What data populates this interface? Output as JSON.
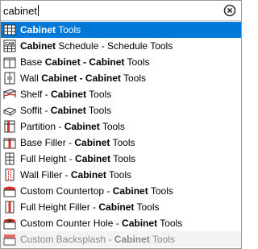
{
  "search": {
    "value": "cabinet",
    "placeholder": ""
  },
  "results": [
    {
      "icon": "cabinet-tools-icon",
      "match": "Cabinet",
      "rest": " Tools",
      "selected": true
    },
    {
      "icon": "cabinet-schedule-icon",
      "match": "Cabinet",
      "rest": " Schedule - Schedule Tools"
    },
    {
      "icon": "base-cabinet-icon",
      "prefix": "Base ",
      "match": "Cabinet - Cabinet",
      "rest": " Tools"
    },
    {
      "icon": "wall-cabinet-icon",
      "prefix": "Wall ",
      "match": "Cabinet - Cabinet",
      "rest": " Tools"
    },
    {
      "icon": "shelf-icon",
      "prefix": "Shelf - ",
      "match": "Cabinet",
      "rest": " Tools"
    },
    {
      "icon": "soffit-icon",
      "prefix": "Soffit - ",
      "match": "Cabinet",
      "rest": " Tools"
    },
    {
      "icon": "partition-icon",
      "prefix": "Partition - ",
      "match": "Cabinet",
      "rest": " Tools"
    },
    {
      "icon": "base-filler-icon",
      "prefix": "Base Filler - ",
      "match": "Cabinet",
      "rest": " Tools"
    },
    {
      "icon": "full-height-icon",
      "prefix": "Full Height - ",
      "match": "Cabinet",
      "rest": " Tools"
    },
    {
      "icon": "wall-filler-icon",
      "prefix": "Wall Filler - ",
      "match": "Cabinet",
      "rest": " Tools"
    },
    {
      "icon": "custom-countertop-icon",
      "prefix": "Custom Countertop - ",
      "match": "Cabinet",
      "rest": " Tools"
    },
    {
      "icon": "full-height-filler-icon",
      "prefix": "Full Height Filler - ",
      "match": "Cabinet",
      "rest": " Tools"
    },
    {
      "icon": "custom-counter-hole-icon",
      "prefix": "Custom Counter Hole - ",
      "match": "Cabinet",
      "rest": " Tools"
    },
    {
      "icon": "custom-backsplash-icon",
      "prefix": "Custom Backsplash - ",
      "match": "Cabinet",
      "rest": " Tools",
      "disabled": true
    }
  ],
  "colors": {
    "selection": "#0078d7",
    "accent_red": "#d9312b",
    "icon_gray": "#555555"
  }
}
